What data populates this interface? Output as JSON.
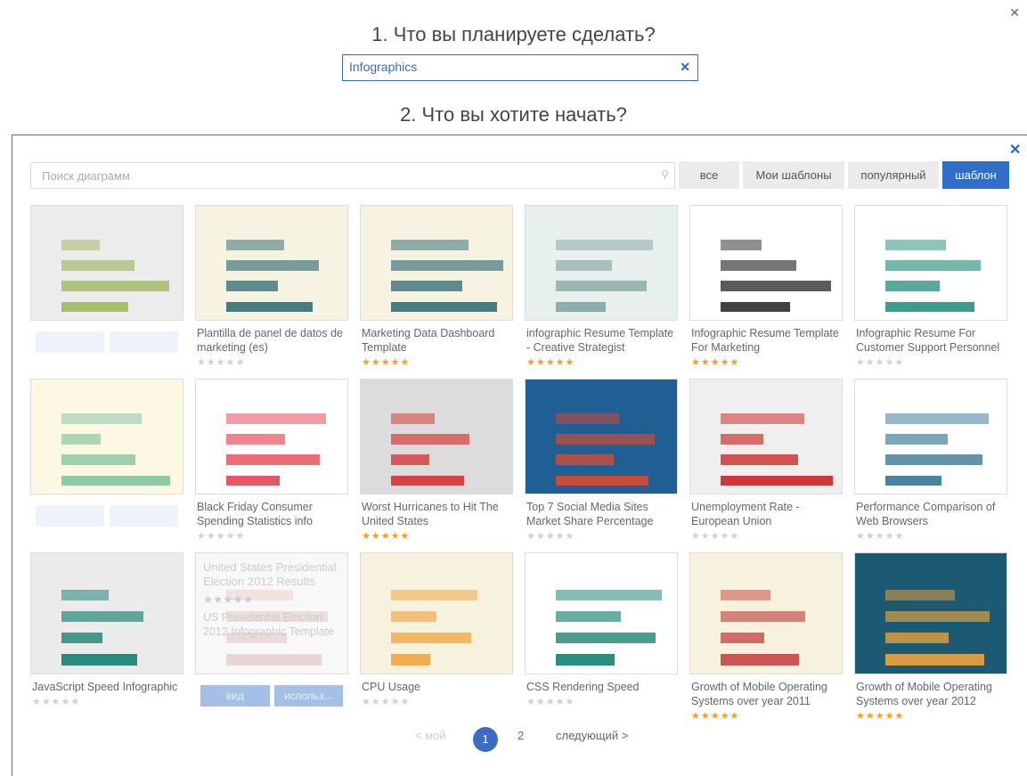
{
  "header": {
    "step1": "1. Что вы планируете сделать?",
    "query": "Infographics",
    "step2": "2. Что вы хотите начать?"
  },
  "search": {
    "placeholder": "Поиск диаграмм"
  },
  "filters": [
    {
      "label": "все"
    },
    {
      "label": "Мои шаблоны"
    },
    {
      "label": "популярный"
    },
    {
      "label": "шаблон"
    }
  ],
  "cards": [
    {
      "title": "",
      "stars": 0,
      "bg": "#ececec",
      "accent": "#9bb35a"
    },
    {
      "title": "Plantilla de panel de datos de marketing (es)",
      "stars": 0,
      "bg": "#f7f3e3",
      "accent": "#2a6670"
    },
    {
      "title": "Marketing Data Dashboard Template",
      "stars": 5,
      "bg": "#f7f3e3",
      "accent": "#2a6670"
    },
    {
      "title": "infographic Resume Template - Creative Strategist",
      "stars": 5,
      "bg": "#e7f0ec",
      "accent": "#7fa3a0"
    },
    {
      "title": "Infographic  Resume Template For Marketing",
      "stars": 5,
      "bg": "#ffffff",
      "accent": "#222222"
    },
    {
      "title": "Infographic Resume For Customer Support Personnel",
      "stars": 0,
      "bg": "#ffffff",
      "accent": "#1e8a78"
    },
    {
      "title": "",
      "stars": 0,
      "bg": "#fdf8e4",
      "accent": "#7cc29a"
    },
    {
      "title": "Black Friday Consumer Spending Statistics info",
      "stars": 0,
      "bg": "#ffffff",
      "accent": "#e33a4a"
    },
    {
      "title": "Worst Hurricanes to Hit The United States",
      "stars": 5,
      "bg": "#dcdcdc",
      "accent": "#d42a2a"
    },
    {
      "title": "Top 7 Social Media Sites Market Share Percentage",
      "stars": 0,
      "bg": "#1f5f93",
      "accent": "#e24a2a"
    },
    {
      "title": "Unemployment Rate - European Union",
      "stars": 0,
      "bg": "#efefef",
      "accent": "#c91a1a"
    },
    {
      "title": "Performance Comparison of Web Browsers",
      "stars": 0,
      "bg": "#ffffff",
      "accent": "#2c6f90"
    },
    {
      "title": "JavaScript Speed Infographic",
      "stars": 0,
      "bg": "#ebebeb",
      "accent": "#0c7a68"
    },
    {
      "title": "",
      "stars": 0,
      "bg": "#f1f1f1",
      "accent": "#b55050"
    },
    {
      "title": "CPU Usage",
      "stars": 0,
      "bg": "#f7f2dd",
      "accent": "#f0a23c"
    },
    {
      "title": "CSS Rendering Speed",
      "stars": 0,
      "bg": "#ffffff",
      "accent": "#0c7a68"
    },
    {
      "title": "Growth of Mobile Operating Systems over year 2011",
      "stars": 5,
      "bg": "#f7f2dd",
      "accent": "#c23d3d"
    },
    {
      "title": "Growth of Mobile Operating Systems over year 2012",
      "stars": 5,
      "bg": "#1c5a74",
      "accent": "#f5a63a"
    }
  ],
  "hover_card": {
    "title": "United States Presidential Election 2012 Results",
    "description": "US Presidential Election 2012 Infographic Template",
    "view": "вид",
    "use": "использ..."
  },
  "pager": {
    "prev": "< мой",
    "page1": "1",
    "page2": "2",
    "next": "следующий >"
  }
}
